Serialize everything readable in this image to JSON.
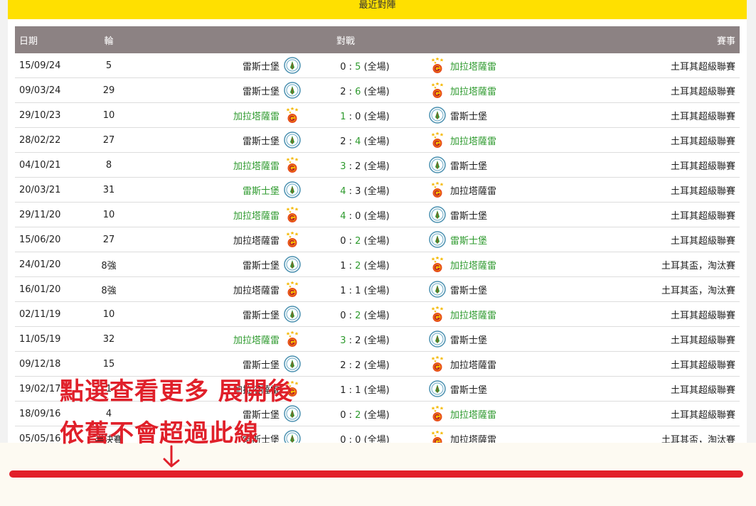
{
  "section": {
    "title": "最近對陣"
  },
  "table": {
    "headers": {
      "date": "日期",
      "round": "輪",
      "match": "對戰",
      "competition": "賽事"
    },
    "rows": [
      {
        "date": "15/09/24",
        "round": "5",
        "home": "雷斯士堡",
        "home_crest": "rizespor-crest-icon",
        "home_win": false,
        "hg": "0",
        "ag": "5",
        "note": "(全場)",
        "away": "加拉塔薩雷",
        "away_crest": "galatasaray-crest-icon",
        "away_win": true,
        "competition": "土耳其超級聯賽"
      },
      {
        "date": "09/03/24",
        "round": "29",
        "home": "雷斯士堡",
        "home_crest": "rizespor-crest-icon",
        "home_win": false,
        "hg": "2",
        "ag": "6",
        "note": "(全場)",
        "away": "加拉塔薩雷",
        "away_crest": "galatasaray-crest-icon",
        "away_win": true,
        "competition": "土耳其超級聯賽"
      },
      {
        "date": "29/10/23",
        "round": "10",
        "home": "加拉塔薩雷",
        "home_crest": "galatasaray-crest-icon",
        "home_win": true,
        "hg": "1",
        "ag": "0",
        "note": "(全場)",
        "away": "雷斯士堡",
        "away_crest": "rizespor-crest-icon",
        "away_win": false,
        "competition": "土耳其超級聯賽"
      },
      {
        "date": "28/02/22",
        "round": "27",
        "home": "雷斯士堡",
        "home_crest": "rizespor-crest-icon",
        "home_win": false,
        "hg": "2",
        "ag": "4",
        "note": "(全場)",
        "away": "加拉塔薩雷",
        "away_crest": "galatasaray-crest-icon",
        "away_win": true,
        "competition": "土耳其超級聯賽"
      },
      {
        "date": "04/10/21",
        "round": "8",
        "home": "加拉塔薩雷",
        "home_crest": "galatasaray-crest-icon",
        "home_win": true,
        "hg": "3",
        "ag": "2",
        "note": "(全場)",
        "away": "雷斯士堡",
        "away_crest": "rizespor-crest-icon",
        "away_win": false,
        "competition": "土耳其超級聯賽"
      },
      {
        "date": "20/03/21",
        "round": "31",
        "home": "雷斯士堡",
        "home_crest": "rizespor-crest-icon",
        "home_win": true,
        "hg": "4",
        "ag": "3",
        "note": "(全場)",
        "away": "加拉塔薩雷",
        "away_crest": "galatasaray-crest-icon",
        "away_win": false,
        "competition": "土耳其超級聯賽"
      },
      {
        "date": "29/11/20",
        "round": "10",
        "home": "加拉塔薩雷",
        "home_crest": "galatasaray-crest-icon",
        "home_win": true,
        "hg": "4",
        "ag": "0",
        "note": "(全場)",
        "away": "雷斯士堡",
        "away_crest": "rizespor-crest-icon",
        "away_win": false,
        "competition": "土耳其超級聯賽"
      },
      {
        "date": "15/06/20",
        "round": "27",
        "home": "加拉塔薩雷",
        "home_crest": "galatasaray-crest-icon",
        "home_win": false,
        "hg": "0",
        "ag": "2",
        "note": "(全場)",
        "away": "雷斯士堡",
        "away_crest": "rizespor-crest-icon",
        "away_win": true,
        "competition": "土耳其超級聯賽"
      },
      {
        "date": "24/01/20",
        "round": "8強",
        "home": "雷斯士堡",
        "home_crest": "rizespor-crest-icon",
        "home_win": false,
        "hg": "1",
        "ag": "2",
        "note": "(全場)",
        "away": "加拉塔薩雷",
        "away_crest": "galatasaray-crest-icon",
        "away_win": true,
        "competition": "土耳其盃，淘汰賽"
      },
      {
        "date": "16/01/20",
        "round": "8強",
        "home": "加拉塔薩雷",
        "home_crest": "galatasaray-crest-icon",
        "home_win": false,
        "hg": "1",
        "ag": "1",
        "note": "(全場)",
        "away": "雷斯士堡",
        "away_crest": "rizespor-crest-icon",
        "away_win": false,
        "competition": "土耳其盃，淘汰賽"
      },
      {
        "date": "02/11/19",
        "round": "10",
        "home": "雷斯士堡",
        "home_crest": "rizespor-crest-icon",
        "home_win": false,
        "hg": "0",
        "ag": "2",
        "note": "(全場)",
        "away": "加拉塔薩雷",
        "away_crest": "galatasaray-crest-icon",
        "away_win": true,
        "competition": "土耳其超級聯賽"
      },
      {
        "date": "11/05/19",
        "round": "32",
        "home": "加拉塔薩雷",
        "home_crest": "galatasaray-crest-icon",
        "home_win": true,
        "hg": "3",
        "ag": "2",
        "note": "(全場)",
        "away": "雷斯士堡",
        "away_crest": "rizespor-crest-icon",
        "away_win": false,
        "competition": "土耳其超級聯賽"
      },
      {
        "date": "09/12/18",
        "round": "15",
        "home": "雷斯士堡",
        "home_crest": "rizespor-crest-icon",
        "home_win": false,
        "hg": "2",
        "ag": "2",
        "note": "(全場)",
        "away": "加拉塔薩雷",
        "away_crest": "galatasaray-crest-icon",
        "away_win": false,
        "competition": "土耳其超級聯賽"
      },
      {
        "date": "19/02/17",
        "round": "1",
        "home": "加拉塔薩雷",
        "home_crest": "galatasaray-crest-icon",
        "home_win": false,
        "hg": "1",
        "ag": "1",
        "note": "(全場)",
        "away": "雷斯士堡",
        "away_crest": "rizespor-crest-icon",
        "away_win": false,
        "competition": "土耳其超級聯賽"
      },
      {
        "date": "18/09/16",
        "round": "4",
        "home": "雷斯士堡",
        "home_crest": "rizespor-crest-icon",
        "home_win": false,
        "hg": "0",
        "ag": "2",
        "note": "(全場)",
        "away": "加拉塔薩雷",
        "away_crest": "galatasaray-crest-icon",
        "away_win": true,
        "competition": "土耳其超級聯賽"
      },
      {
        "date": "05/05/16",
        "round": "半決賽",
        "home": "雷斯士堡",
        "home_crest": "rizespor-crest-icon",
        "home_win": false,
        "hg": "0",
        "ag": "0",
        "note": "(全場)",
        "away": "加拉塔薩雷",
        "away_crest": "galatasaray-crest-icon",
        "away_win": false,
        "competition": "土耳其盃，淘汰賽"
      }
    ]
  },
  "annotation": {
    "line1": "點選查看更多 展開後",
    "line2": "依舊不會超過此線",
    "arrow_icon": "down-arrow-icon"
  },
  "colors": {
    "header_bg": "#8c8283",
    "title_bar": "#ffe000",
    "winner_text": "#2e9a2e",
    "annotation_red": "#e0202a"
  }
}
